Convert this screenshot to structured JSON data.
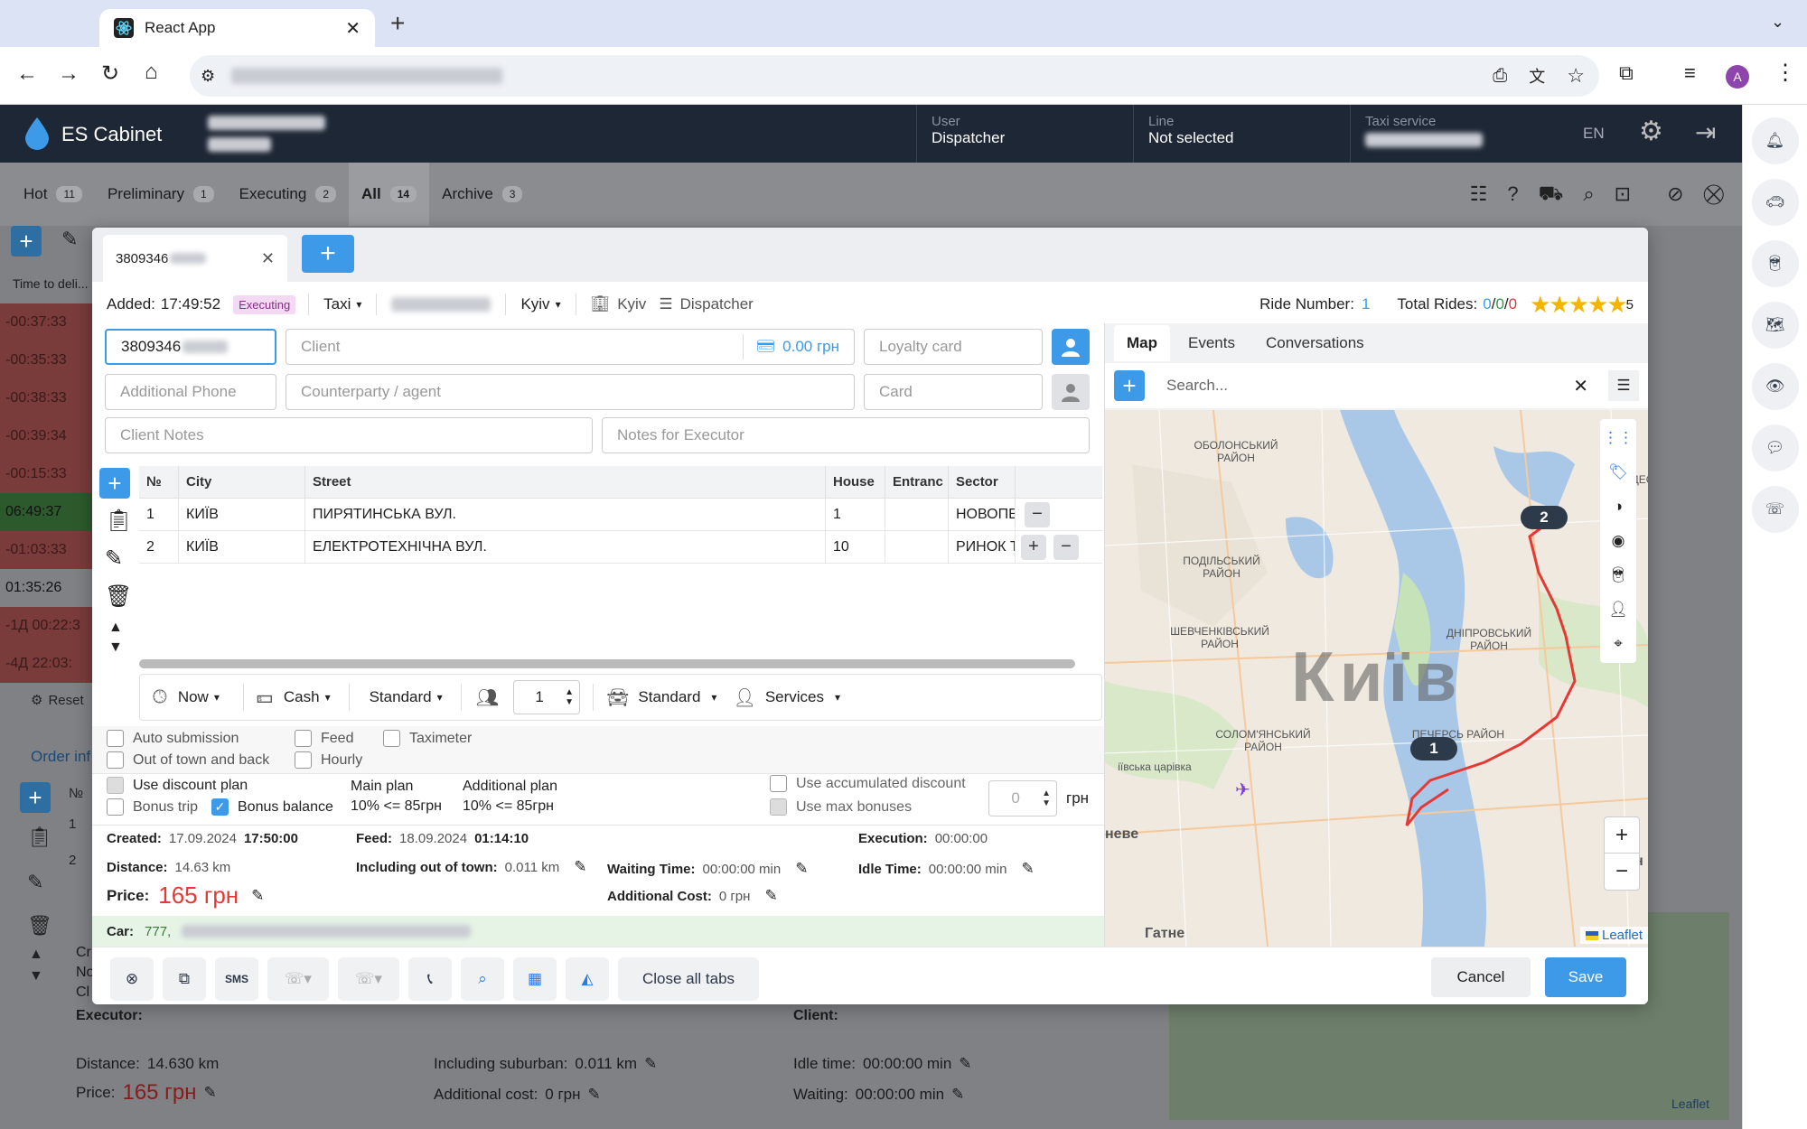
{
  "browser": {
    "tab_title": "React App",
    "profile": "A"
  },
  "app": {
    "brand": "ES Cabinet",
    "user_label": "User",
    "user_value": "Dispatcher",
    "line_label": "Line",
    "line_value": "Not selected",
    "taxi_label": "Taxi service",
    "lang": "EN"
  },
  "order_tabs": [
    {
      "label": "Hot",
      "count": "11"
    },
    {
      "label": "Preliminary",
      "count": "1"
    },
    {
      "label": "Executing",
      "count": "2"
    },
    {
      "label": "All",
      "count": "14"
    },
    {
      "label": "Archive",
      "count": "3"
    }
  ],
  "bg_list": {
    "header": "Time to deli...",
    "times": [
      "-00:37:33",
      "-00:35:33",
      "-00:38:33",
      "-00:39:34",
      "-00:15:33",
      "06:49:37",
      "-01:03:33",
      "01:35:26",
      "-1Д 00:22:3",
      "-4Д 22:03:"
    ],
    "reset": "Reset",
    "order_info": "Order inf",
    "col_no": "№",
    "rows": [
      "1",
      "2"
    ],
    "cr": "Cr",
    "no": "No",
    "cl": "Cl",
    "executor": "Executor:",
    "client": "Client:",
    "distance_label": "Distance:",
    "distance_value": "14.630 km",
    "suburban_label": "Including suburban:",
    "suburban_value": "0.011 km",
    "idle_label": "Idle time:",
    "idle_value": "00:00:00 min",
    "price_label": "Price:",
    "price_value": "165 грн",
    "addcost_label": "Additional cost:",
    "addcost_value": "0 грн",
    "waiting_label": "Waiting:",
    "waiting_value": "00:00:00 min",
    "leaflet": "Leaflet"
  },
  "modal": {
    "tab_phone": "3809346",
    "added_label": "Added:",
    "added_time": "17:49:52",
    "status": "Executing",
    "service": "Taxi",
    "city": "Kyiv",
    "city2": "Kyiv",
    "role": "Dispatcher",
    "ride_number_label": "Ride Number:",
    "ride_number": "1",
    "total_rides_label": "Total Rides:",
    "total_rides_a": "0",
    "total_rides_b": "0",
    "total_rides_c": "0",
    "rating": "5",
    "phone_value": "3809346",
    "client_placeholder": "Client",
    "balance": "0.00 грн",
    "loyalty_placeholder": "Loyalty card",
    "add_phone_placeholder": "Additional Phone",
    "counterparty_placeholder": "Counterparty / agent",
    "card_placeholder": "Card",
    "client_notes_placeholder": "Client Notes",
    "executor_notes_placeholder": "Notes for Executor",
    "route_headers": [
      "№",
      "City",
      "Street",
      "House",
      "Entranc",
      "Sector"
    ],
    "route_rows": [
      {
        "no": "1",
        "city": "КИЇВ",
        "street": "ПИРЯТИНСЬКА ВУЛ.",
        "house": "1",
        "entrance": "",
        "sector": "НОВОПЕЧ"
      },
      {
        "no": "2",
        "city": "КИЇВ",
        "street": "ЕЛЕКТРОТЕХНІЧНА ВУЛ.",
        "house": "10",
        "entrance": "",
        "sector": "РИНОК ТІ"
      }
    ],
    "when": "Now",
    "payment": "Cash",
    "tariff": "Standard",
    "passengers": "1",
    "car_class": "Standard",
    "services": "Services",
    "auto_submission": "Auto submission",
    "feed": "Feed",
    "taximeter": "Taximeter",
    "out_of_town": "Out of town and back",
    "hourly": "Hourly",
    "use_discount": "Use discount plan",
    "bonus_trip": "Bonus trip",
    "bonus_balance": "Bonus balance",
    "main_plan_label": "Main plan",
    "main_plan_value": "10% <= 85грн",
    "add_plan_label": "Additional plan",
    "add_plan_value": "10% <= 85грн",
    "use_accum": "Use accumulated discount",
    "use_max_bonus": "Use max bonuses",
    "discount_value": "0",
    "currency": "грн",
    "created_label": "Created:",
    "created_date": "17.09.2024",
    "created_time": "17:50:00",
    "feed_label": "Feed:",
    "feed_date": "18.09.2024",
    "feed_time": "01:14:10",
    "execution_label": "Execution:",
    "execution_value": "00:00:00",
    "distance_label": "Distance:",
    "distance_value": "14.63 km",
    "out_town_label": "Including out of town:",
    "out_town_value": "0.011 km",
    "waiting_label": "Waiting Time:",
    "waiting_value": "00:00:00 min",
    "idle_label": "Idle Time:",
    "idle_value": "00:00:00 min",
    "price_label": "Price:",
    "price_value": "165 грн",
    "addcost_label": "Additional Cost:",
    "addcost_value": "0 грн",
    "car_label": "Car:",
    "car_value": "777,",
    "close_all": "Close all tabs",
    "cancel": "Cancel",
    "save": "Save"
  },
  "map": {
    "tabs": [
      "Map",
      "Events",
      "Conversations"
    ],
    "search_placeholder": "Search...",
    "city_label": "Київ",
    "districts": [
      "ОБОЛОНСЬКИЙ РАЙОН",
      "ПОДІЛЬСЬКИЙ РАЙОН",
      "ШЕВЧЕНКІВСЬКИЙ РАЙОН",
      "ДНІПРОВСЬКИЙ РАЙОН",
      "СОЛОМ'ЯНСЬКИЙ РАЙОН",
      "ПЕЧЕРСЬ РАЙОН",
      "ДЕС",
      "іївська царівка",
      "неве",
      "Гатне",
      "Дарн"
    ],
    "marker1": "1",
    "marker2": "2",
    "leaflet": "Leaflet"
  },
  "colors": {
    "accent": "#3d9ae8",
    "header": "#1e2735",
    "red_price": "#e53935",
    "status_bg": "#f3d9f3"
  }
}
